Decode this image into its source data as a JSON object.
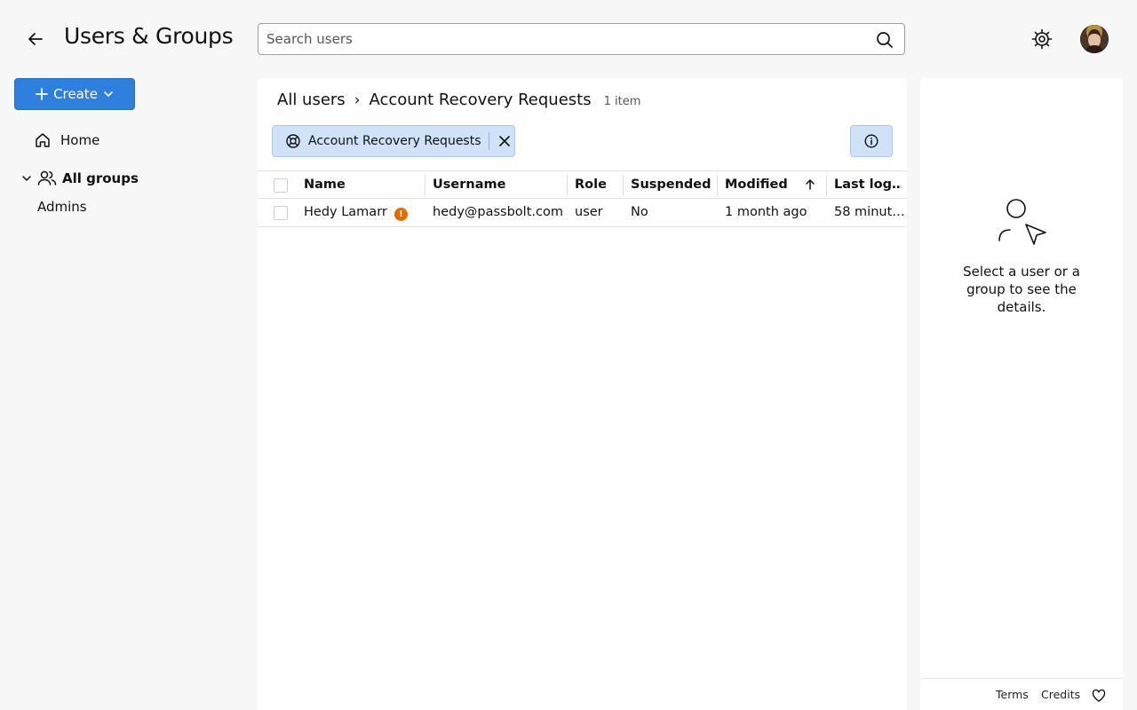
{
  "header": {
    "title": "Users & Groups",
    "search": {
      "placeholder": "Search users",
      "value": ""
    }
  },
  "sidebar": {
    "create_label": "Create",
    "home_label": "Home",
    "all_groups_label": "All groups",
    "groups": [
      "Admins"
    ]
  },
  "main": {
    "breadcrumb": [
      "All users",
      "Account Recovery Requests"
    ],
    "separator": "›",
    "item_count": "1 item",
    "filter_chip": "Account Recovery Requests",
    "table": {
      "columns": [
        "Name",
        "Username",
        "Role",
        "Suspended",
        "Modified",
        "Last log…"
      ],
      "sorted_column": "Modified",
      "sort_direction": "ascending",
      "rows": [
        {
          "name": "Hedy Lamarr",
          "username": "hedy@passbolt.com",
          "role": "user",
          "suspended": "No",
          "modified": "1 month ago",
          "last_logged_in": "58 minut…",
          "badge": "!"
        }
      ]
    }
  },
  "details_panel": {
    "empty_message": "Select a user or a group to see the details."
  },
  "footer": {
    "terms": "Terms",
    "credits": "Credits"
  },
  "colors": {
    "primary": "#2f7fde",
    "chip_bg": "#cfe2f7",
    "warning": "#e06b00"
  }
}
